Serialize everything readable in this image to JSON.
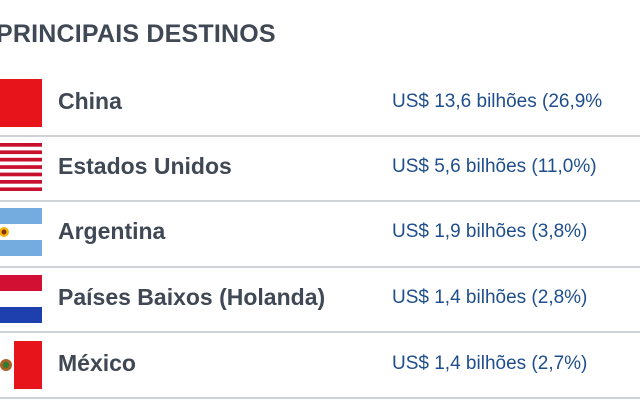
{
  "header": {
    "title": "PRINCIPAIS DESTINOS"
  },
  "destinations": [
    {
      "country": "China",
      "value": "US$ 13,6 bilhões (26,9%",
      "flag_icon": "china-flag-icon"
    },
    {
      "country": "Estados Unidos",
      "value": "US$ 5,6 bilhões (11,0%)",
      "flag_icon": "usa-flag-icon"
    },
    {
      "country": "Argentina",
      "value": "US$ 1,9 bilhões (3,8%)",
      "flag_icon": "argentina-flag-icon"
    },
    {
      "country": "Países Baixos (Holanda)",
      "value": "US$ 1,4 bilhões (2,8%)",
      "flag_icon": "netherlands-flag-icon"
    },
    {
      "country": "México",
      "value": "US$ 1,4 bilhões (2,7%)",
      "flag_icon": "mexico-flag-icon"
    }
  ],
  "colors": {
    "title": "#3f4854",
    "value_text": "#1f4e8c",
    "divider": "#cfd3d7"
  }
}
